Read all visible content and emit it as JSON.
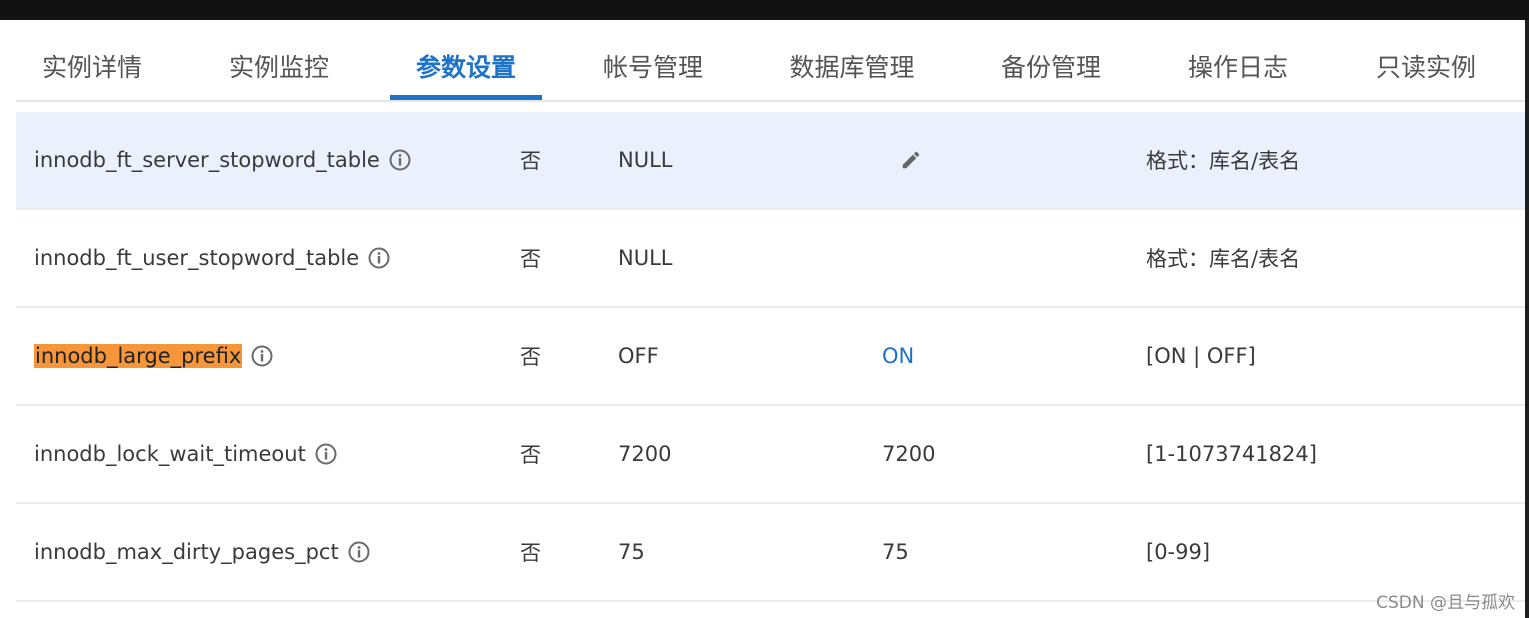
{
  "tabs": [
    {
      "label": "实例详情",
      "active": false
    },
    {
      "label": "实例监控",
      "active": false
    },
    {
      "label": "参数设置",
      "active": true
    },
    {
      "label": "帐号管理",
      "active": false
    },
    {
      "label": "数据库管理",
      "active": false
    },
    {
      "label": "备份管理",
      "active": false
    },
    {
      "label": "操作日志",
      "active": false
    },
    {
      "label": "只读实例",
      "active": false
    }
  ],
  "rows": [
    {
      "name": "innodb_ft_server_stopword_table",
      "restart": "否",
      "default": "NULL",
      "current": "",
      "range": "格式：库名/表名"
    },
    {
      "name": "innodb_ft_user_stopword_table",
      "restart": "否",
      "default": "NULL",
      "current": "",
      "range": "格式：库名/表名"
    },
    {
      "name": "innodb_large_prefix",
      "restart": "否",
      "default": "OFF",
      "current": "ON",
      "range": "[ON | OFF]"
    },
    {
      "name": "innodb_lock_wait_timeout",
      "restart": "否",
      "default": "7200",
      "current": "7200",
      "range": "[1-1073741824]"
    },
    {
      "name": "innodb_max_dirty_pages_pct",
      "restart": "否",
      "default": "75",
      "current": "75",
      "range": "[0-99]"
    }
  ],
  "watermark": "CSDN @且与孤欢",
  "icons": {
    "info": "info-circle-icon",
    "edit": "pencil-edit-icon"
  },
  "colors": {
    "accent": "#1e73c8",
    "highlight": "#f7953a",
    "hover_row": "#eaf1fd"
  }
}
